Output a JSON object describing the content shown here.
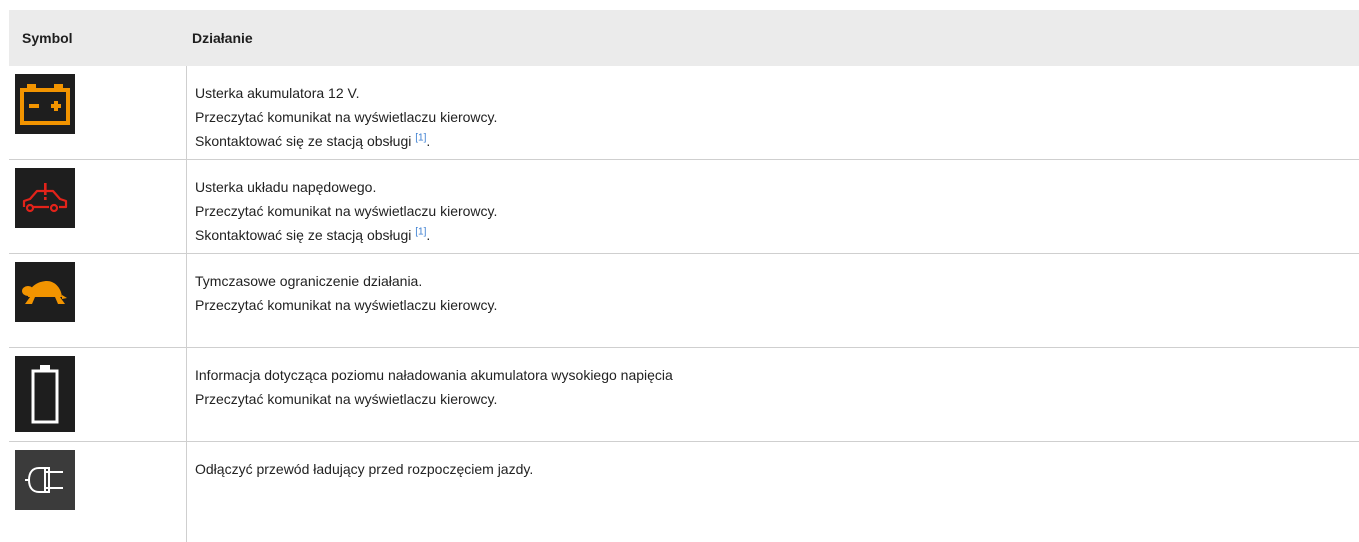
{
  "table": {
    "headers": {
      "symbol": "Symbol",
      "action": "Działanie"
    },
    "rows": [
      {
        "icon": "battery-12v-warning-icon",
        "lines": [
          "Usterka akumulatora 12 V.",
          "Przeczytać komunikat na wyświetlaczu kierowcy."
        ],
        "contact": {
          "text": "Skontaktować się ze stacją obsługi ",
          "ref": "[1]",
          "end": "."
        }
      },
      {
        "icon": "powertrain-fault-icon",
        "lines": [
          "Usterka układu napędowego.",
          "Przeczytać komunikat na wyświetlaczu kierowcy."
        ],
        "contact": {
          "text": "Skontaktować się ze stacją obsługi ",
          "ref": "[1]",
          "end": "."
        }
      },
      {
        "icon": "turtle-limited-performance-icon",
        "lines": [
          "Tymczasowe ograniczenie działania.",
          "Przeczytać komunikat na wyświetlaczu kierowcy."
        ]
      },
      {
        "icon": "high-voltage-battery-level-icon",
        "lines": [
          "Informacja dotycząca poziomu naładowania akumulatora wysokiego napięcia",
          "Przeczytać komunikat na wyświetlaczu kierowcy."
        ]
      },
      {
        "icon": "charging-cable-plug-icon",
        "lines": [
          "Odłączyć przewód ładujący przed rozpoczęciem jazdy."
        ]
      }
    ]
  },
  "colors": {
    "amber": "#f29400",
    "red": "#e2231a",
    "white": "#ffffff",
    "icon_bg": "#1e1e1e",
    "link": "#3d7fd1"
  }
}
